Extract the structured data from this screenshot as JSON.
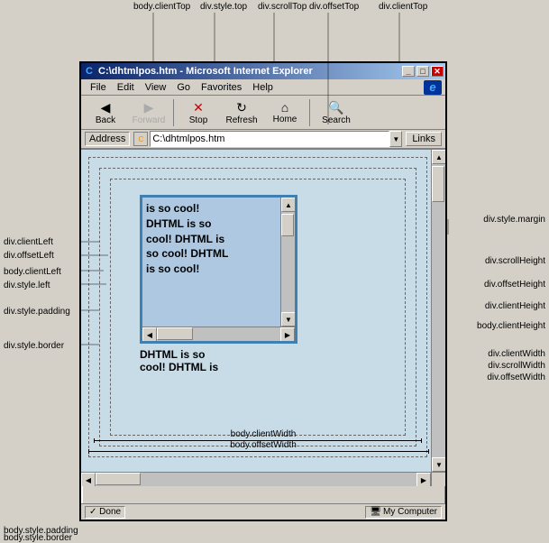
{
  "annotations": {
    "body_client_top": "body.clientTop",
    "div_style_top": "div.style.top",
    "div_scroll_top": "div.scrollTop",
    "div_offset_top": "div.offsetTop",
    "div_client_top_top": "div.clientTop",
    "div_style_margin": "div.style.margin",
    "div_client_left": "div.clientLeft",
    "div_offset_left": "div.offsetLeft",
    "body_client_left": "body.clientLeft",
    "div_style_left": "div.style.left",
    "div_style_padding": "div.style.padding",
    "div_style_border": "div.style.border",
    "div_scroll_height": "div.scrollHeight",
    "div_offset_height": "div.offsetHeight",
    "div_client_height": "div.clientHeight",
    "body_client_height": "body.clientHeight",
    "div_client_width": "div.clientWidth",
    "div_scroll_width": "div.scrollWidth",
    "div_offset_width": "div.offsetWidth",
    "body_client_width": "body.clientWidth",
    "body_offset_width": "body.offsetWidth",
    "body_style_padding": "body.style.padding",
    "body_style_border": "body.style.border"
  },
  "browser": {
    "title": "C:\\dhtmlpos.htm - Microsoft Internet Explorer",
    "title_icon": "C",
    "menu_items": [
      "File",
      "Edit",
      "View",
      "Go",
      "Favorites",
      "Help"
    ],
    "toolbar_buttons": [
      {
        "label": "Back",
        "icon": "◀"
      },
      {
        "label": "Forward",
        "icon": "▶"
      },
      {
        "label": "Stop",
        "icon": "✕"
      },
      {
        "label": "Refresh",
        "icon": "↻"
      },
      {
        "label": "Home",
        "icon": "🏠"
      },
      {
        "label": "Search",
        "icon": "🔍"
      }
    ],
    "address_label": "Address",
    "address_value": "C:\\dhtmlpos.htm",
    "links_label": "Links",
    "status_done": "Done",
    "status_zone": "My Computer",
    "title_buttons": [
      "_",
      "□",
      "✕"
    ]
  },
  "div_content": "DHTML is so cool! DHTML is so cool! DHTML is so cool! DHTML is so cool! DHTML is so cool! DHTML is so"
}
